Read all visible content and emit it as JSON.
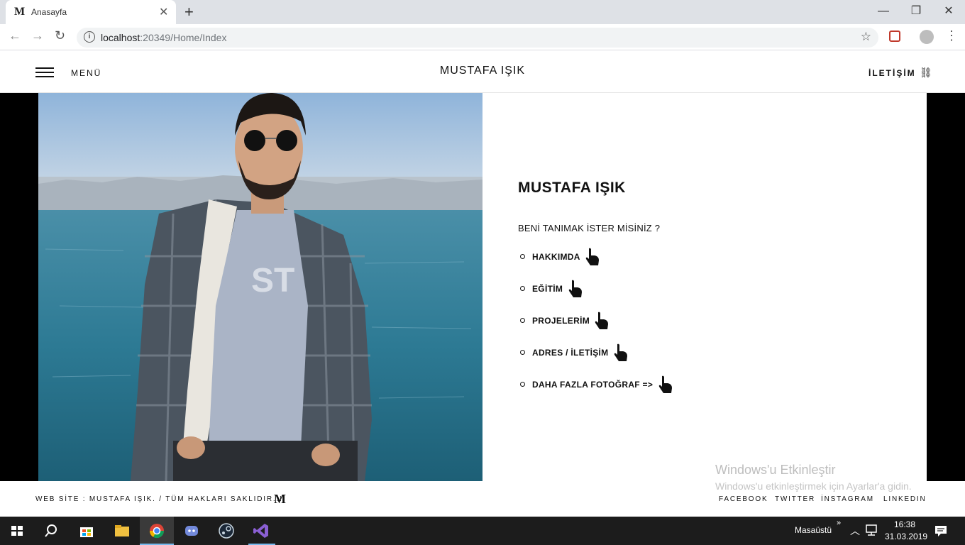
{
  "browser": {
    "tab_title": "Anasayfa",
    "tab_favicon": "M",
    "url_host": "localhost",
    "url_rest": ":20349/Home/Index"
  },
  "header": {
    "menu_label": "MENÜ",
    "brand": "MUSTAFA IŞIK",
    "contact_label": "İLETİŞİM"
  },
  "hero": {
    "name": "MUSTAFA IŞIK",
    "question": "BENİ TANIMAK İSTER MİSİNİZ ?",
    "links": [
      {
        "label": "HAKKIMDA"
      },
      {
        "label": "EĞİTİM"
      },
      {
        "label": "PROJELERİM"
      },
      {
        "label": "ADRES / İLETİŞİM"
      },
      {
        "label": "DAHA FAZLA FOTOĞRAF =>"
      }
    ]
  },
  "watermark": {
    "title": "Windows'u Etkinleştir",
    "subtitle": "Windows'u etkinleştirmek için Ayarlar'a gidin."
  },
  "footer": {
    "copyright": "WEB SİTE : MUSTAFA IŞIK. / TÜM HAKLARI SAKLIDIR..!",
    "logo": "M",
    "social": [
      "FACEBOOK",
      "TWITTER",
      "İNSTAGRAM",
      "LINKEDIN"
    ]
  },
  "taskbar": {
    "desktop_label": "Masaüstü",
    "chevron": "»",
    "time": "16:38",
    "date": "31.03.2019"
  }
}
